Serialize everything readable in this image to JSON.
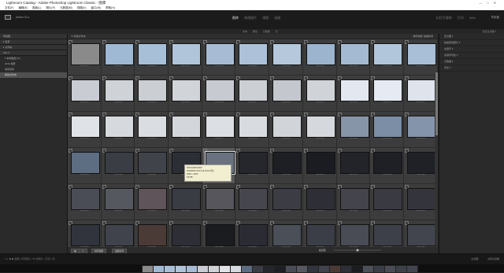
{
  "window": {
    "title": "Lightroom Catalog - Adobe Photoshop Lightroom Classic - 图库",
    "menu": [
      "文件(F)",
      "编辑(E)",
      "图库(L)",
      "照片(P)",
      "元数据(M)",
      "视图(V)",
      "窗口(W)",
      "帮助(H)"
    ],
    "buttons": [
      "—",
      "□",
      "✕"
    ]
  },
  "identity": {
    "catalog": "Adobe ID ▸",
    "modules_left": [
      "图库",
      "修改照片",
      "地图",
      "画册"
    ],
    "modules_right": [
      "幻灯片放映",
      "打印",
      "Web"
    ],
    "right_label": "导航器"
  },
  "filter": {
    "items": [
      "文本",
      "属性",
      "元数据",
      "无"
    ],
    "right": "自定过滤器 ▾"
  },
  "left_panel": {
    "header": "导航器",
    "sections": [
      {
        "label": "▸ 目录"
      },
      {
        "label": "▸ 文件夹"
      },
      {
        "label": "Mac ▾"
      }
    ],
    "tree": [
      {
        "label": "▾ 本地磁盘 (D:)",
        "sel": false
      },
      {
        "label": "  2019 相册",
        "sel": false
      },
      {
        "label": "  城市建筑",
        "sel": false
      },
      {
        "label": "  新建文件夹",
        "sel": true
      }
    ]
  },
  "right_panel": {
    "rows": [
      "直方图 ▾",
      "快速修改照片 ▾",
      "关键字 ▾",
      "关键字列表 ▾",
      "元数据 ▾",
      "评论 ▾"
    ]
  },
  "grid": {
    "header_label": "▼ 新建文件夹",
    "sort_label": "排序依据: 拍摄时间",
    "cells": [
      {
        "c": "#8a8a8a",
        "n": "DSC01001"
      },
      {
        "c": "#9fb8d4",
        "n": "DSC01002"
      },
      {
        "c": "#a8bfd8",
        "n": "DSC01003"
      },
      {
        "c": "#b0c4da",
        "n": "DSC01004"
      },
      {
        "c": "#a7bcd4",
        "n": "DSC01005"
      },
      {
        "c": "#adc2d9",
        "n": "DSC01006"
      },
      {
        "c": "#b5c8dc",
        "n": "DSC01007"
      },
      {
        "c": "#9cb4ce",
        "n": "DSC01008"
      },
      {
        "c": "#a4bad2",
        "n": "DSC01009"
      },
      {
        "c": "#b2c6db",
        "n": "DSC01010"
      },
      {
        "c": "#a9bfd7",
        "n": "DSC01011"
      },
      {
        "c": "#c9ccd2",
        "n": "DSC01012"
      },
      {
        "c": "#cfd2d6",
        "n": "DSC01013"
      },
      {
        "c": "#cbced3",
        "n": "DSC01014"
      },
      {
        "c": "#d1d4d8",
        "n": "DSC01015"
      },
      {
        "c": "#c7cbd1",
        "n": "DSC01016"
      },
      {
        "c": "#ccd0d5",
        "n": "DSC01017"
      },
      {
        "c": "#c4c8ce",
        "n": "DSC01018"
      },
      {
        "c": "#d0d3d7",
        "n": "DSC01019"
      },
      {
        "c": "#e3e7f0",
        "n": "DSC01020"
      },
      {
        "c": "#e6eaf2",
        "n": "DSC01021"
      },
      {
        "c": "#dfe3ec",
        "n": "DSC01022"
      },
      {
        "c": "#dfe2e6",
        "n": "DSC01023"
      },
      {
        "c": "#d6d9de",
        "n": "DSC01024"
      },
      {
        "c": "#dadde2",
        "n": "DSC01025"
      },
      {
        "c": "#d3d6db",
        "n": "DSC01026"
      },
      {
        "c": "#dcdfe3",
        "n": "DSC01027"
      },
      {
        "c": "#d8dbe0",
        "n": "DSC01028"
      },
      {
        "c": "#d1d4d9",
        "n": "DSC01029"
      },
      {
        "c": "#d5d8dc",
        "n": "DSC01030"
      },
      {
        "c": "#8795a8",
        "n": "DSC01031"
      },
      {
        "c": "#7c8ea6",
        "n": "DSC01032"
      },
      {
        "c": "#8494aa",
        "n": "DSC01033"
      },
      {
        "c": "#5d6d82",
        "n": "DSC01034"
      },
      {
        "c": "#3b3d45",
        "n": "DSC01035"
      },
      {
        "c": "#41434a",
        "n": "DSC01036"
      },
      {
        "c": "#2c2e35",
        "n": "DSC01037"
      },
      {
        "c": "#6a7280",
        "n": "DSC01038"
      },
      {
        "c": "#25272d",
        "n": "DSC01039"
      },
      {
        "c": "#1d1f24",
        "n": "DSC01040"
      },
      {
        "c": "#1a1c22",
        "n": "DSC01041"
      },
      {
        "c": "#22242a",
        "n": "DSC01042"
      },
      {
        "c": "#1e2026",
        "n": "DSC01043"
      },
      {
        "c": "#1f2127",
        "n": "DSC01044"
      },
      {
        "c": "#4a4d55",
        "n": "DSC01045"
      },
      {
        "c": "#56585f",
        "n": "DSC01046"
      },
      {
        "c": "#5e545a",
        "n": "DSC01047"
      },
      {
        "c": "#3a3c43",
        "n": "DSC01048"
      },
      {
        "c": "#56565c",
        "n": "DSC01049"
      },
      {
        "c": "#46474e",
        "n": "DSC01050"
      },
      {
        "c": "#3c3d44",
        "n": "DSC01051"
      },
      {
        "c": "#2e2f36",
        "n": "DSC01052"
      },
      {
        "c": "#44454c",
        "n": "DSC01053"
      },
      {
        "c": "#3a3b42",
        "n": "DSC01054"
      },
      {
        "c": "#34353c",
        "n": "DSC01055"
      },
      {
        "c": "#31343d",
        "n": "DSC01056"
      },
      {
        "c": "#41434c",
        "n": "DSC01057"
      },
      {
        "c": "#4b3b36",
        "n": "DSC01058"
      },
      {
        "c": "#2e2f36",
        "n": "DSC01059"
      },
      {
        "c": "#1b1c20",
        "n": "DSC01060"
      },
      {
        "c": "#2b2c33",
        "n": "DSC01061"
      },
      {
        "c": "#4b4f58",
        "n": "DSC01062"
      },
      {
        "c": "#3b3e46",
        "n": "DSC01063"
      },
      {
        "c": "#494c55",
        "n": "DSC01064"
      },
      {
        "c": "#3d4048",
        "n": "DSC01065"
      },
      {
        "c": "#42454e",
        "n": "DSC01066"
      }
    ],
    "tooltip_lines": [
      "DSC01038.ARW",
      "2019/8/25 18:44:18 (1/100 秒)",
      "6000 x 4000",
      "18 MB"
    ]
  },
  "toolbar": {
    "view_icons": [
      "▦",
      "▭"
    ],
    "sort_label": "排序依据",
    "sort_value": "拍摄时间",
    "thumb_label": "缩览图"
  },
  "status": {
    "left": "1 2 ◀ ▶ 图库 | 所有照片 | 66 张照片 / 已选 1 张",
    "right": [
      "过滤器:",
      "关闭过滤器"
    ]
  },
  "filmstrip": {
    "colors": [
      "#8a8a8a",
      "#9fb8d4",
      "#a8bfd8",
      "#b0c4da",
      "#a7bcd4",
      "#c9ccd2",
      "#cfd2d6",
      "#dfe2e6",
      "#d6d9de",
      "#5d6d82",
      "#3b3d45",
      "#25272d",
      "#1d1f24",
      "#4a4d55",
      "#56585f",
      "#31343d",
      "#41434c",
      "#4b3b36",
      "#2e2f36",
      "#1b1c20",
      "#4b4f58",
      "#3b3e46",
      "#494c55",
      "#3d4048",
      "#42454e"
    ]
  }
}
